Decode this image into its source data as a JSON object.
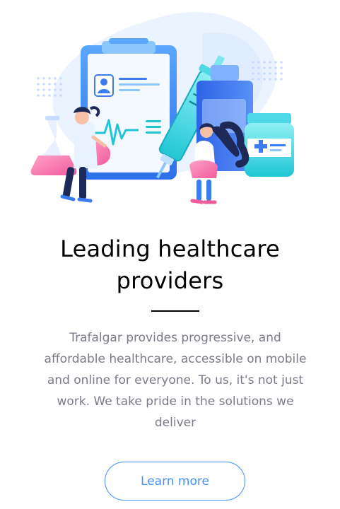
{
  "section": {
    "title_line1": "Leading healthcare",
    "title_line2": "providers",
    "description": "Trafalgar provides progressive, and affordable healthcare, accessible on mobile and online for everyone. To us, it's not just work. We take pride in the solutions we deliver",
    "button_label": "Learn more"
  },
  "colors": {
    "accent": "#458ff6",
    "text_gray": "#7d7987",
    "heading": "#000000"
  },
  "illustration": {
    "icon": "healthcare-providers-illustration"
  }
}
